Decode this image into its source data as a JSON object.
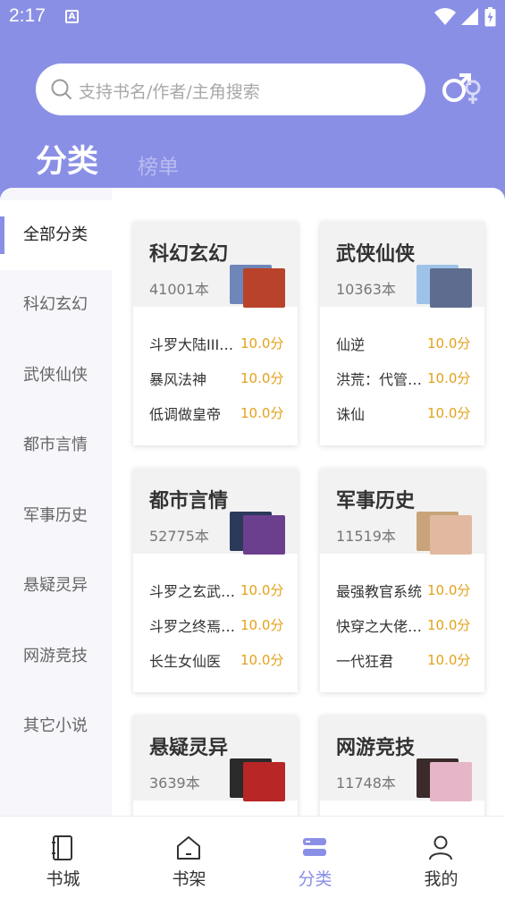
{
  "status": {
    "time": "2:17",
    "a_icon_label": "A"
  },
  "search": {
    "placeholder": "支持书名/作者/主角搜索"
  },
  "tabs": [
    {
      "label": "分类"
    },
    {
      "label": "榜单"
    }
  ],
  "sidebar": {
    "items": [
      {
        "label": "全部分类"
      },
      {
        "label": "科幻玄幻"
      },
      {
        "label": "武侠仙侠"
      },
      {
        "label": "都市言情"
      },
      {
        "label": "军事历史"
      },
      {
        "label": "悬疑灵异"
      },
      {
        "label": "网游竞技"
      },
      {
        "label": "其它小说"
      }
    ]
  },
  "cards": [
    {
      "title": "科幻玄幻",
      "count": "41001本",
      "cover_colors": [
        "#6f86b8",
        "#b8432a"
      ],
      "books": [
        {
          "name": "斗罗大陆III龙王传说",
          "score": "10.0分"
        },
        {
          "name": "暴风法神",
          "score": "10.0分"
        },
        {
          "name": "低调做皇帝",
          "score": "10.0分"
        }
      ]
    },
    {
      "title": "武侠仙侠",
      "count": "10363本",
      "cover_colors": [
        "#9fc3e8",
        "#5e6d8f"
      ],
      "books": [
        {
          "name": "仙逆",
          "score": "10.0分"
        },
        {
          "name": "洪荒：代管截教",
          "score": "10.0分"
        },
        {
          "name": "诛仙",
          "score": "10.0分"
        }
      ]
    },
    {
      "title": "都市言情",
      "count": "52775本",
      "cover_colors": [
        "#2b3a5a",
        "#6b3f8e"
      ],
      "books": [
        {
          "name": "斗罗之玄武神魂",
          "score": "10.0分"
        },
        {
          "name": "斗罗之终焉魔王",
          "score": "10.0分"
        },
        {
          "name": "长生女仙医",
          "score": "10.0分"
        }
      ]
    },
    {
      "title": "军事历史",
      "count": "11519本",
      "cover_colors": [
        "#c9a47a",
        "#e0b9a0"
      ],
      "books": [
        {
          "name": "最强教官系统",
          "score": "10.0分"
        },
        {
          "name": "快穿之大佬又疯了",
          "score": "10.0分"
        },
        {
          "name": "一代狂君",
          "score": "10.0分"
        }
      ]
    },
    {
      "title": "悬疑灵异",
      "count": "3639本",
      "cover_colors": [
        "#2a2a2a",
        "#b82626"
      ],
      "books": []
    },
    {
      "title": "网游竞技",
      "count": "11748本",
      "cover_colors": [
        "#3a2a2a",
        "#e6b5c8"
      ],
      "books": []
    }
  ],
  "bottom_nav": [
    {
      "label": "书城",
      "icon": "book-icon"
    },
    {
      "label": "书架",
      "icon": "house-icon"
    },
    {
      "label": "分类",
      "icon": "category-icon",
      "active": true
    },
    {
      "label": "我的",
      "icon": "person-icon"
    }
  ],
  "colors": {
    "accent": "#8a8fe6",
    "score": "#e3a21a"
  }
}
